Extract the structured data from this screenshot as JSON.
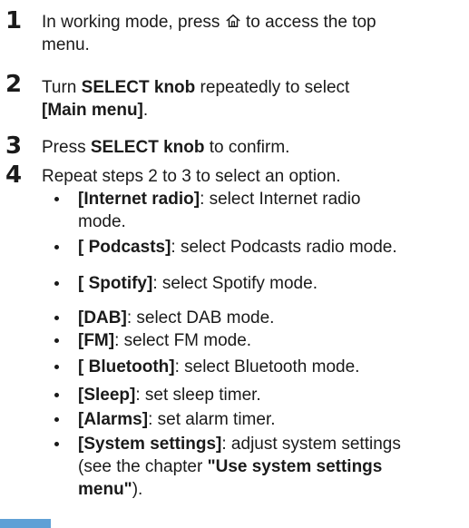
{
  "steps": [
    {
      "number": "1",
      "text_before": "In working mode, press",
      "icon": "home-icon",
      "text_after": "to access the top menu."
    },
    {
      "number": "2",
      "text_a": "Turn ",
      "bold_a": "SELECT knob",
      "text_b": "  repeatedly to select ",
      "bold_b": "[Main menu]",
      "text_c": "."
    },
    {
      "number": "3",
      "text_a": "Press ",
      "bold_a": "SELECT knob",
      "text_b": " to confirm."
    },
    {
      "number": "4",
      "text": "Repeat steps 2 to 3 to select an option."
    }
  ],
  "options": [
    {
      "label": "[Internet radio]",
      "desc": ": select Internet radio mode."
    },
    {
      "label": "[ Podcasts]",
      "desc": ": select Podcasts radio mode."
    },
    {
      "label": "[ Spotify]",
      "desc": ": select Spotify mode."
    },
    {
      "label": "[DAB]",
      "desc": ": select DAB mode."
    },
    {
      "label": "[FM]",
      "desc": ": select FM mode."
    },
    {
      "label": "[ Bluetooth]",
      "desc": ": select Bluetooth mode."
    },
    {
      "label": "[Sleep]",
      "desc": ": set sleep timer."
    },
    {
      "label": "[Alarms]",
      "desc": ": set alarm timer."
    },
    {
      "label": "[System settings]",
      "desc": ": adjust system settings (see the chapter ",
      "bold_tail": "\"Use system settings menu\"",
      "tail_end": ")."
    }
  ],
  "colors": {
    "accent_tab": "#5fa0d6",
    "text": "#1a1a1a"
  }
}
